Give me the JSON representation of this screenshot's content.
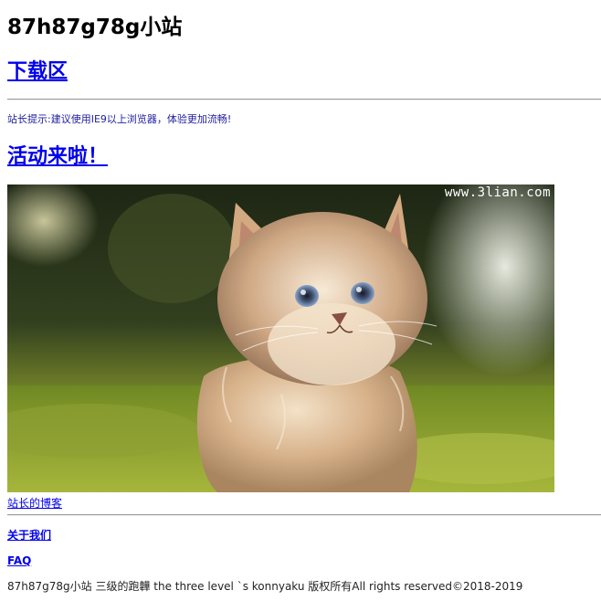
{
  "header": {
    "site_title": "87h87g78g小站"
  },
  "nav": {
    "download_label": "下载区",
    "event_label": "活动来啦！"
  },
  "notice": {
    "tip": "站长提示:建议使用IE9以上浏览器，体验更加流畅!"
  },
  "banner": {
    "watermark": "www.3lian.com",
    "subject": "kitten-photo"
  },
  "links": {
    "blog_label": "站长的博客",
    "about_label": "关于我们",
    "faq_label": "FAQ"
  },
  "footer": {
    "copyright": "87h87g78g小站 三级的跑韡 the three level `s konnyaku 版权所有All rights reserved©2018-2019"
  },
  "colors": {
    "link": "#0000ee",
    "tip_text": "#2020a0"
  }
}
